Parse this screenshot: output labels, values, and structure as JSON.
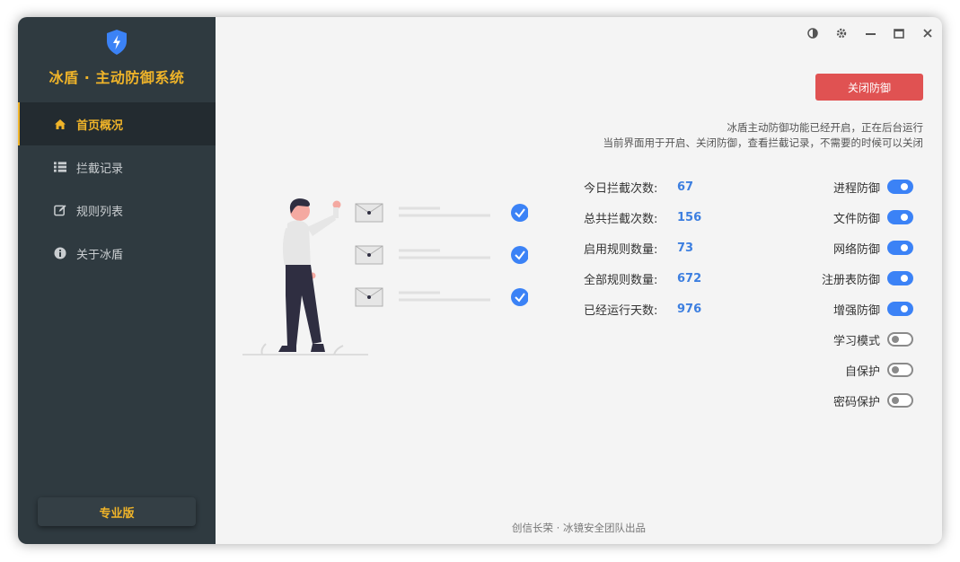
{
  "app": {
    "title": "冰盾 · 主动防御系统",
    "accent": "#f0b429",
    "sidebar_bg": "#2f3a40"
  },
  "sidebar": {
    "items": [
      {
        "label": "首页概况",
        "icon": "home-icon",
        "active": true
      },
      {
        "label": "拦截记录",
        "icon": "list-icon",
        "active": false
      },
      {
        "label": "规则列表",
        "icon": "edit-icon",
        "active": false
      },
      {
        "label": "关于冰盾",
        "icon": "info-icon",
        "active": false
      }
    ],
    "pro_label": "专业版"
  },
  "window_controls": [
    "theme-contrast-icon",
    "gear-icon",
    "minimize-icon",
    "maximize-icon",
    "close-icon"
  ],
  "main": {
    "close_defense_label": "关闭防御",
    "close_defense_color": "#e05252",
    "desc_line1": "冰盾主动防御功能已经开启，正在后台运行",
    "desc_line2": "当前界面用于开启、关闭防御，查看拦截记录，不需要的时候可以关闭"
  },
  "stats": [
    {
      "label": "今日拦截次数:",
      "value": "67"
    },
    {
      "label": "总共拦截次数:",
      "value": "156"
    },
    {
      "label": "启用规则数量:",
      "value": "73"
    },
    {
      "label": "全部规则数量:",
      "value": "672"
    },
    {
      "label": "已经运行天数:",
      "value": "976"
    }
  ],
  "toggles": [
    {
      "label": "进程防御",
      "on": true
    },
    {
      "label": "文件防御",
      "on": true
    },
    {
      "label": "网络防御",
      "on": true
    },
    {
      "label": "注册表防御",
      "on": true
    },
    {
      "label": "增强防御",
      "on": true
    },
    {
      "label": "学习模式",
      "on": false
    },
    {
      "label": "自保护",
      "on": false
    },
    {
      "label": "密码保护",
      "on": false
    }
  ],
  "footer": "创信长荣 · 冰镜安全团队出品",
  "colors": {
    "value_blue": "#3d7fe0",
    "switch_on": "#3b82f6"
  }
}
